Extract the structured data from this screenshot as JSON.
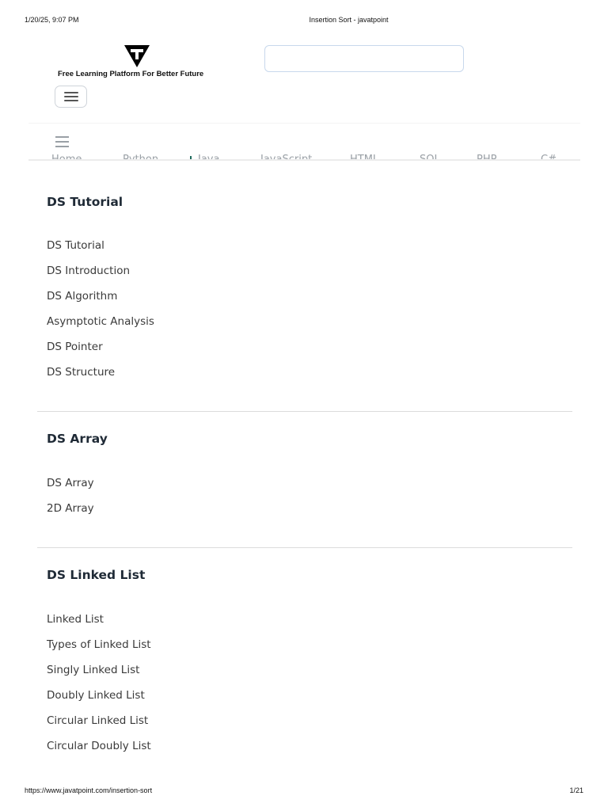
{
  "print_header": {
    "datetime": "1/20/25, 9:07 PM",
    "page_title": "Insertion Sort - javatpoint"
  },
  "brand": {
    "logo_icon": "javatpoint-t-logo-icon",
    "tagline": "Free Learning Platform For Better Future"
  },
  "search": {
    "value": "",
    "placeholder": ""
  },
  "nav": {
    "links": [
      "Home",
      "Python",
      "Java",
      "JavaScript",
      "HTML",
      "SQL",
      "PHP",
      "C#"
    ]
  },
  "sections": [
    {
      "title": "DS Tutorial",
      "items": [
        "DS Tutorial",
        "DS Introduction",
        "DS Algorithm",
        "Asymptotic Analysis",
        "DS Pointer",
        "DS Structure"
      ]
    },
    {
      "title": "DS Array",
      "items": [
        "DS Array",
        "2D Array"
      ]
    },
    {
      "title": "DS Linked List",
      "items": [
        "Linked List",
        "Types of Linked List",
        "Singly Linked List",
        "Doubly Linked List",
        "Circular Linked List",
        "Circular Doubly List"
      ]
    }
  ],
  "print_footer": {
    "url": "https://www.javatpoint.com/insertion-sort",
    "page": "1/21"
  }
}
